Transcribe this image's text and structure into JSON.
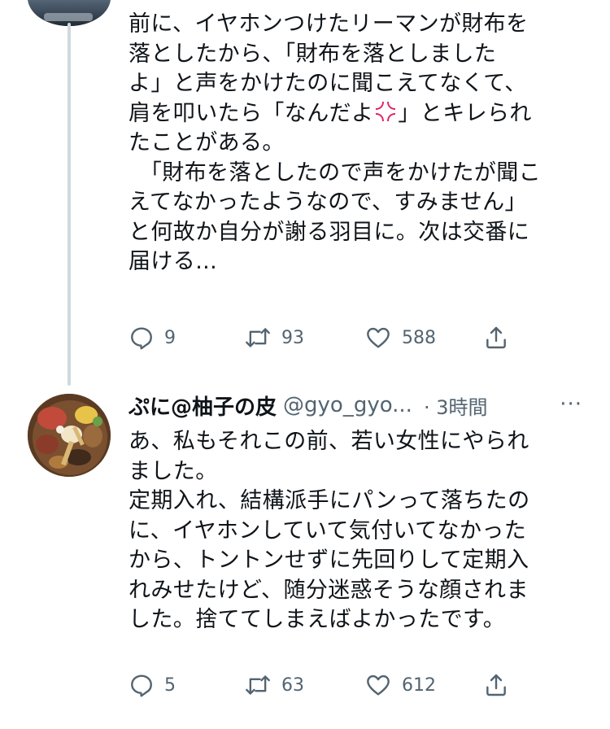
{
  "tweet_1": {
    "lines": [
      "前に、イヤホンつけたリーマンが財布を",
      "落としたから、「財布を落としました",
      "よ」と声をかけたのに聞こえてなくて、",
      "肩を叩いたら「なんだよ",
      "」とキレられ",
      "たことがある。",
      "　「財布を落としたので声をかけたが聞こ",
      "えてなかったようなので、すみません」",
      "と何故か自分が謝る羽目に。次は交番に",
      "届ける..."
    ],
    "emoji_icon": "anger-symbol-icon",
    "stats": {
      "replies": "9",
      "retweets": "93",
      "likes": "588"
    }
  },
  "tweet_2": {
    "name": "ぷに@柚子の皮",
    "handle": "@gyo_gyo...",
    "time": "· 3時間",
    "more": "···",
    "lines": [
      "あ、私もそれこの前、若い女性にやられ",
      "ました。",
      "定期入れ、結構派手にパンって落ちたの",
      "に、イヤホンしていて気付いてなかった",
      "から、トントンせずに先回りして定期入",
      "れみせたけど、随分迷惑そうな顔されま",
      "した。捨ててしまえばよかったです。"
    ],
    "stats": {
      "replies": "5",
      "retweets": "63",
      "likes": "612"
    }
  },
  "colors": {
    "text": "#0f1419",
    "secondary": "#536471",
    "thread_line": "#cfd9de",
    "anger_emoji": "#e0245e"
  }
}
